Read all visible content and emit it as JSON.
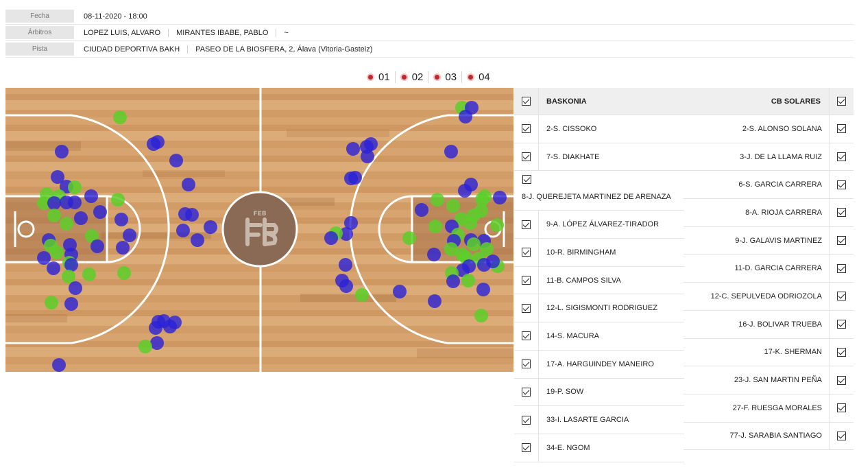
{
  "match_info": [
    {
      "label": "Fecha",
      "values": [
        "08-11-2020 - 18:00"
      ]
    },
    {
      "label": "Árbitros",
      "values": [
        "LOPEZ LUIS, ALVARO",
        "MIRANTES IBABE, PABLO",
        "~"
      ]
    },
    {
      "label": "Pista",
      "values": [
        "CIUDAD DEPORTIVA BAKH",
        "PASEO DE LA BIOSFERA, 2, Álava (Vitoria-Gasteiz)"
      ]
    }
  ],
  "periods": [
    "01",
    "02",
    "03",
    "04"
  ],
  "court_logo": "FEB",
  "colors": {
    "made": "#5ccf2a",
    "missed": "#2a22d8",
    "period_dot": "#c0282d"
  },
  "home": {
    "name": "BASKONIA",
    "players": [
      "2-S. CISSOKO",
      "7-S. DIAKHATE",
      "8-J. QUEREJETA MARTINEZ DE ARENAZA",
      "9-A. LÓPEZ ÁLVAREZ-TIRADOR",
      "10-R. BIRMINGHAM",
      "11-B. CAMPOS SILVA",
      "12-L. SIGISMONTI RODRIGUEZ",
      "14-S. MACURA",
      "17-A. HARGUINDEY MANEIRO",
      "19-P. SOW",
      "33-I. LASARTE GARCIA",
      "34-E. NGOM"
    ]
  },
  "away": {
    "name": "CB SOLARES",
    "players": [
      "2-S. ALONSO SOLANA",
      "3-J. DE LA LLAMA RUIZ",
      "6-S. GARCIA CARRERA",
      "8-A. RIOJA CARRERA",
      "9-J. GALAVIS MARTINEZ",
      "11-D. GARCIA CARRERA",
      "12-C. SEPULVEDA ODRIOZOLA",
      "16-J. BOLIVAR TRUEBA",
      "17-K. SHERMAN",
      "23-J. SAN MARTIN PEÑA",
      "27-F. RUESGA MORALES",
      "77-J. SARABIA SANTIAGO"
    ]
  }
}
